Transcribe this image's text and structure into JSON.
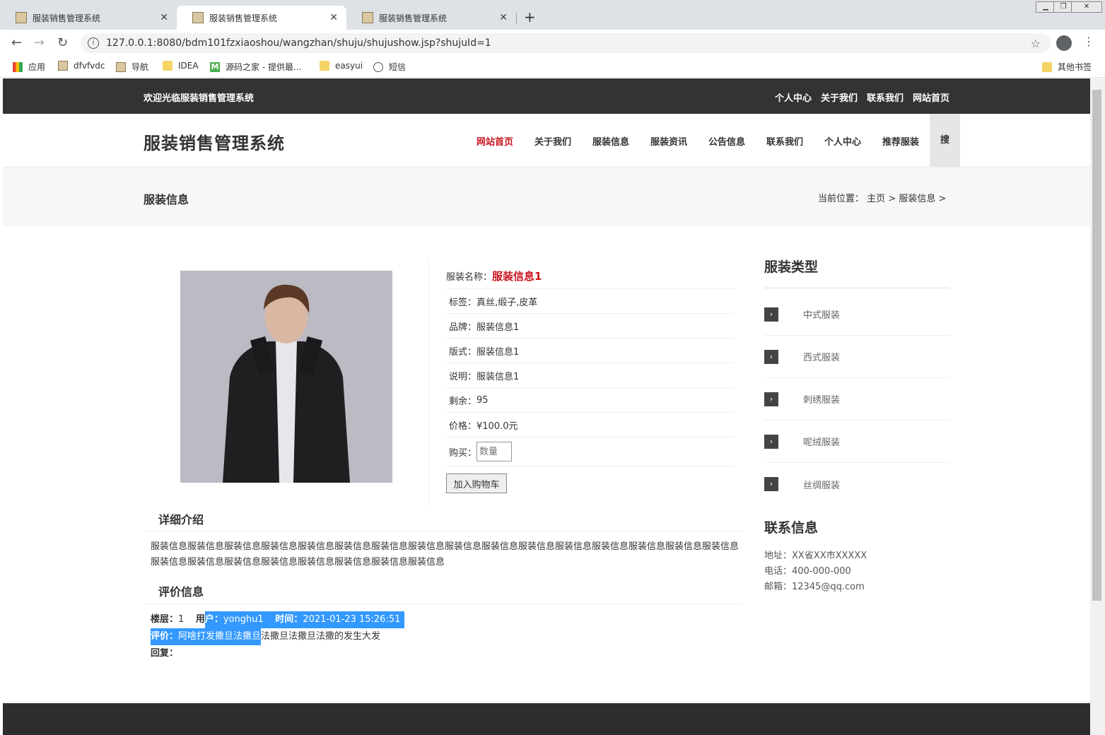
{
  "browser": {
    "tabs": [
      {
        "title": "服装销售管理系统"
      },
      {
        "title": "服装销售管理系统"
      },
      {
        "title": "服装销售管理系统"
      }
    ],
    "new_tab": "+",
    "url": "127.0.0.1:8080/bdm101fzxiaoshou/wangzhan/shuju/shujushow.jsp?shujuId=1",
    "bookmarks": [
      "应用",
      "dfvfvdc",
      "导航",
      "IDEA",
      "源码之家 - 提供最...",
      "easyui",
      "短信"
    ],
    "other_bookmarks": "其他书签"
  },
  "site": {
    "welcome": "欢迎光临服装销售管理系统",
    "top_links": [
      "个人中心",
      "关于我们",
      "联系我们",
      "网站首页"
    ],
    "title": "服装销售管理系统",
    "nav": [
      "网站首页",
      "关于我们",
      "服装信息",
      "服装资讯",
      "公告信息",
      "联系我们",
      "个人中心",
      "推荐服装"
    ],
    "search": "搜",
    "accent": "#c9151e"
  },
  "banner": {
    "title": "服装信息",
    "crumb_prefix": "当前位置：",
    "crumb_home": "主页",
    "crumb_sep1": ">",
    "crumb_current": "服装信息",
    "crumb_sep2": ">"
  },
  "product": {
    "name_label": "服装名称：",
    "name_value": "服装信息1",
    "rows": [
      {
        "label": "标签：",
        "value": "真丝,缎子,皮革"
      },
      {
        "label": "品牌：",
        "value": "服装信息1"
      },
      {
        "label": "版式：",
        "value": "服装信息1"
      },
      {
        "label": "说明：",
        "value": "服装信息1"
      },
      {
        "label": "剩余：",
        "value": "95"
      },
      {
        "label": "价格：",
        "value": "¥100.0元"
      }
    ],
    "buy_label": "购买：",
    "qty_placeholder": "数量",
    "add_cart": "加入购物车"
  },
  "detail": {
    "heading": "详细介绍",
    "text": "服装信息服装信息服装信息服装信息服装信息服装信息服装信息服装信息服装信息服装信息服装信息服装信息服装信息服装信息服装信息服装信息服装信息服装信息服装信息服装信息服装信息服装信息服装信息服装信息"
  },
  "reviews": {
    "heading": "评价信息",
    "floor_label": "楼层：",
    "floor_value": "1",
    "user_label_a": "用",
    "user_label_b": "户：",
    "user_value": "yonghu1",
    "time_label": "时间：",
    "time_value": "2021-01-23 15:26:51",
    "comment_label": "评价：",
    "comment_sel": "阿啥打发撒旦法撒旦",
    "comment_rest": "法撒旦法撒旦法撒的发生大发",
    "reply_label": "回复："
  },
  "sidebar": {
    "category_heading": "服装类型",
    "categories": [
      "中式服装",
      "西式服装",
      "刺绣服装",
      "呢绒服装",
      "丝绸服装"
    ],
    "contact_heading": "联系信息",
    "contact": [
      "地址：XX省XX市XXXXX",
      "电话：400-000-000",
      "邮箱：12345@qq.com"
    ]
  }
}
